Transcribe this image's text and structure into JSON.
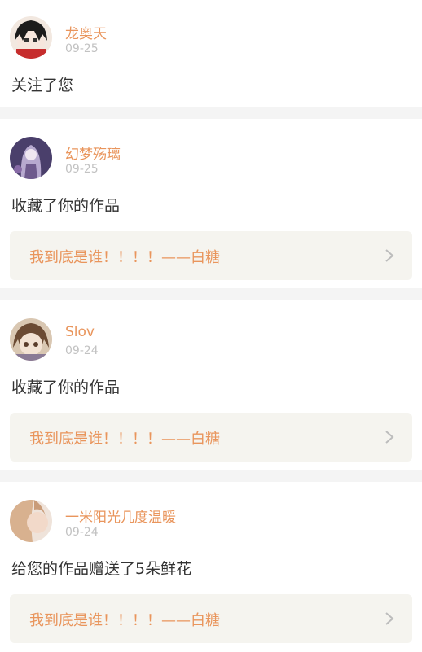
{
  "feed": [
    {
      "name": "龙奥天",
      "date": "09-25",
      "action": "关注了您",
      "avatar_icon": "avatar-icon",
      "work": null
    },
    {
      "name": "幻梦殇璃",
      "date": "09-25",
      "action": "收藏了你的作品",
      "avatar_icon": "avatar-icon",
      "work": "我到底是谁！！！！——白糖"
    },
    {
      "name": "Slov",
      "date": "09-24",
      "action": "收藏了你的作品",
      "avatar_icon": "avatar-icon",
      "work": "我到底是谁！！！！——白糖"
    },
    {
      "name": "一米阳光几度温暖",
      "date": "09-24",
      "action": "给您的作品赠送了5朵鲜花",
      "avatar_icon": "avatar-icon",
      "work": "我到底是谁！！！！——白糖"
    }
  ],
  "chevron_icon": "chevron-right-icon",
  "colors": {
    "accent": "#e9955c",
    "date": "#c2c2c2",
    "work_bg": "#f5f4ef",
    "page_bg": "#f4f4f4"
  }
}
